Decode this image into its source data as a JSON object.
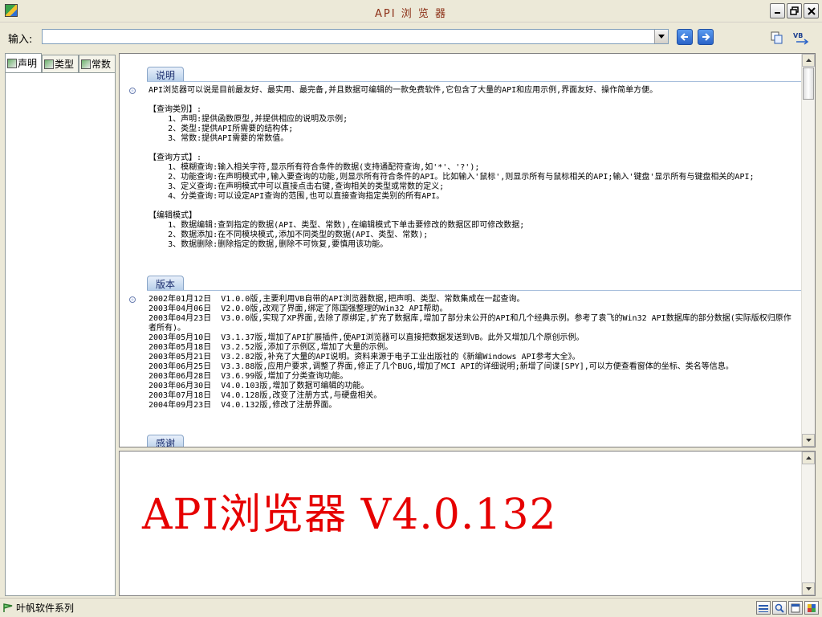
{
  "window": {
    "title": "API 浏 览 器"
  },
  "toolbar": {
    "input_label": "输入:",
    "input_value": "",
    "back_icon": "arrow-left-icon",
    "forward_icon": "arrow-right-icon",
    "copy_icon": "copy-icon",
    "vb_icon": "vb-export-icon"
  },
  "tabs": [
    {
      "label": "声明",
      "icon": "declare-icon"
    },
    {
      "label": "类型",
      "icon": "type-icon"
    },
    {
      "label": "常数",
      "icon": "const-icon"
    }
  ],
  "sections": {
    "shuoming": {
      "title": "说明",
      "intro": "API浏览器可以说是目前最友好、最实用、最完备,并且数据可编辑的一款免费软件,它包含了大量的API和应用示例,界面友好、操作简单方便。",
      "query_category_head": "【查询类别】:",
      "query_category_items": [
        "    1、声明:提供函数原型,并提供相应的说明及示例;",
        "    2、类型:提供API所需要的结构体;",
        "    3、常数:提供API需要的常数值。"
      ],
      "query_method_head": "【查询方式】:",
      "query_method_items": [
        "    1、模糊查询:输入相关字符,显示所有符合条件的数据(支持通配符查询,如'*'、'?');",
        "    2、功能查询:在声明模式中,输入要查询的功能,则显示所有符合条件的API。比如输入'鼠标',则显示所有与鼠标相关的API;输入'键盘'显示所有与键盘相关的API;",
        "    3、定义查询:在声明模式中可以直接点击右键,查询相关的类型或常数的定义;",
        "    4、分类查询:可以设定API查询的范围,也可以直接查询指定类别的所有API。"
      ],
      "edit_mode_head": "【编辑模式】",
      "edit_mode_items": [
        "    1、数据编辑:查到指定的数据(API、类型、常数),在编辑模式下单击要修改的数据区即可修改数据;",
        "    2、数据添加:在不同模块模式,添加不同类型的数据(API、类型、常数);",
        "    3、数据删除:删除指定的数据,删除不可恢复,要慎用该功能。"
      ]
    },
    "banben": {
      "title": "版本",
      "entries": [
        "2002年01月12日  V1.0.0版,主要利用VB自带的API浏览器数据,把声明、类型、常数集成在一起查询。",
        "2003年04月06日  V2.0.0版,改观了界面,绑定了陈国强整理的Win32 API帮助。",
        "2003年04月23日  V3.0.0版,实现了XP界面,去除了原绑定,扩充了数据库,增加了部分未公开的API和几个经典示例。参考了袁飞的Win32 API数据库的部分数据(实际版权归原作者所有)。",
        "2003年05月10日  V3.1.37版,增加了API扩展插件,使API浏览器可以直接把数据发送到VB。此外又增加几个原创示例。",
        "2003年05月18日  V3.2.52版,添加了示例区,增加了大量的示例。",
        "2003年05月21日  V3.2.82版,补充了大量的API说明。资料来源于电子工业出版社的《新编Windows API参考大全》。",
        "2003年06月25日  V3.3.88版,应用户要求,调整了界面,修正了几个BUG,增加了MCI API的详细说明;新增了间谍[SPY],可以方便查看窗体的坐标、类名等信息。",
        "2003年06月28日  V3.6.99版,增加了分类查询功能。",
        "2003年06月30日  V4.0.103版,增加了数据可编辑的功能。",
        "2003年07月18日  V4.0.128版,改变了注册方式,与硬盘相关。",
        "2004年09月23日  V4.0.132版,修改了注册界面。"
      ]
    },
    "ganxie": {
      "title": "感谢"
    }
  },
  "bottom_pane": {
    "big_title": "API浏览器 V4.0.132"
  },
  "statusbar": {
    "text": "叶帆软件系列"
  }
}
